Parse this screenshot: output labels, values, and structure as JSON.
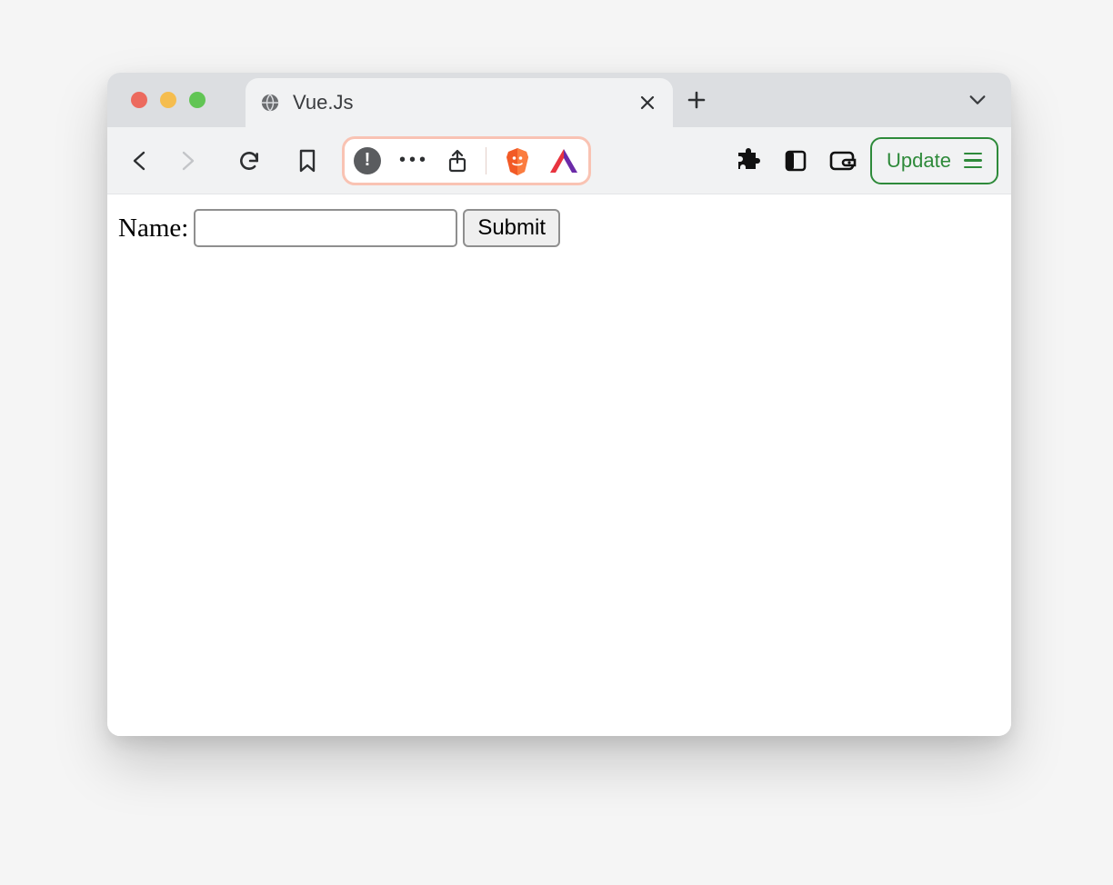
{
  "browser": {
    "tab": {
      "title": "Vue.Js"
    },
    "toolbar": {
      "update_label": "Update"
    }
  },
  "page": {
    "form": {
      "name_label": "Name:",
      "name_value": "",
      "submit_label": "Submit"
    }
  }
}
